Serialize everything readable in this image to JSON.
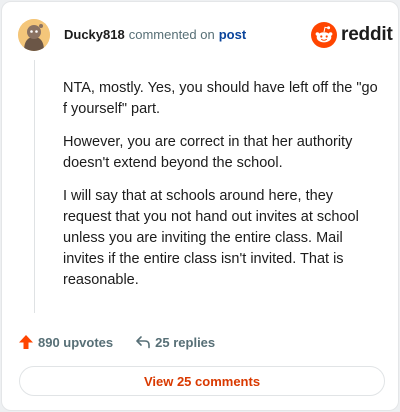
{
  "comment": {
    "username": "Ducky818",
    "action_text": "commented on",
    "target_link": "post",
    "paragraphs": [
      "NTA, mostly. Yes, you should have left off the \"go f yourself\" part.",
      "However, you are correct in that her authority doesn't extend beyond the school.",
      "I will say that at schools around here, they request that you not hand out invites at school unless you are inviting the entire class. Mail invites if the entire class isn't invited. That is reasonable."
    ]
  },
  "brand": {
    "name": "reddit",
    "color": "#ff4500"
  },
  "stats": {
    "upvotes_label": "890 upvotes",
    "replies_label": "25 replies"
  },
  "footer": {
    "view_comments_label": "View 25 comments"
  },
  "icons": {
    "avatar": "snoo-avatar-icon",
    "logo": "reddit-snoo-icon",
    "upvote": "upvote-arrow-icon",
    "reply": "reply-arrow-icon"
  }
}
